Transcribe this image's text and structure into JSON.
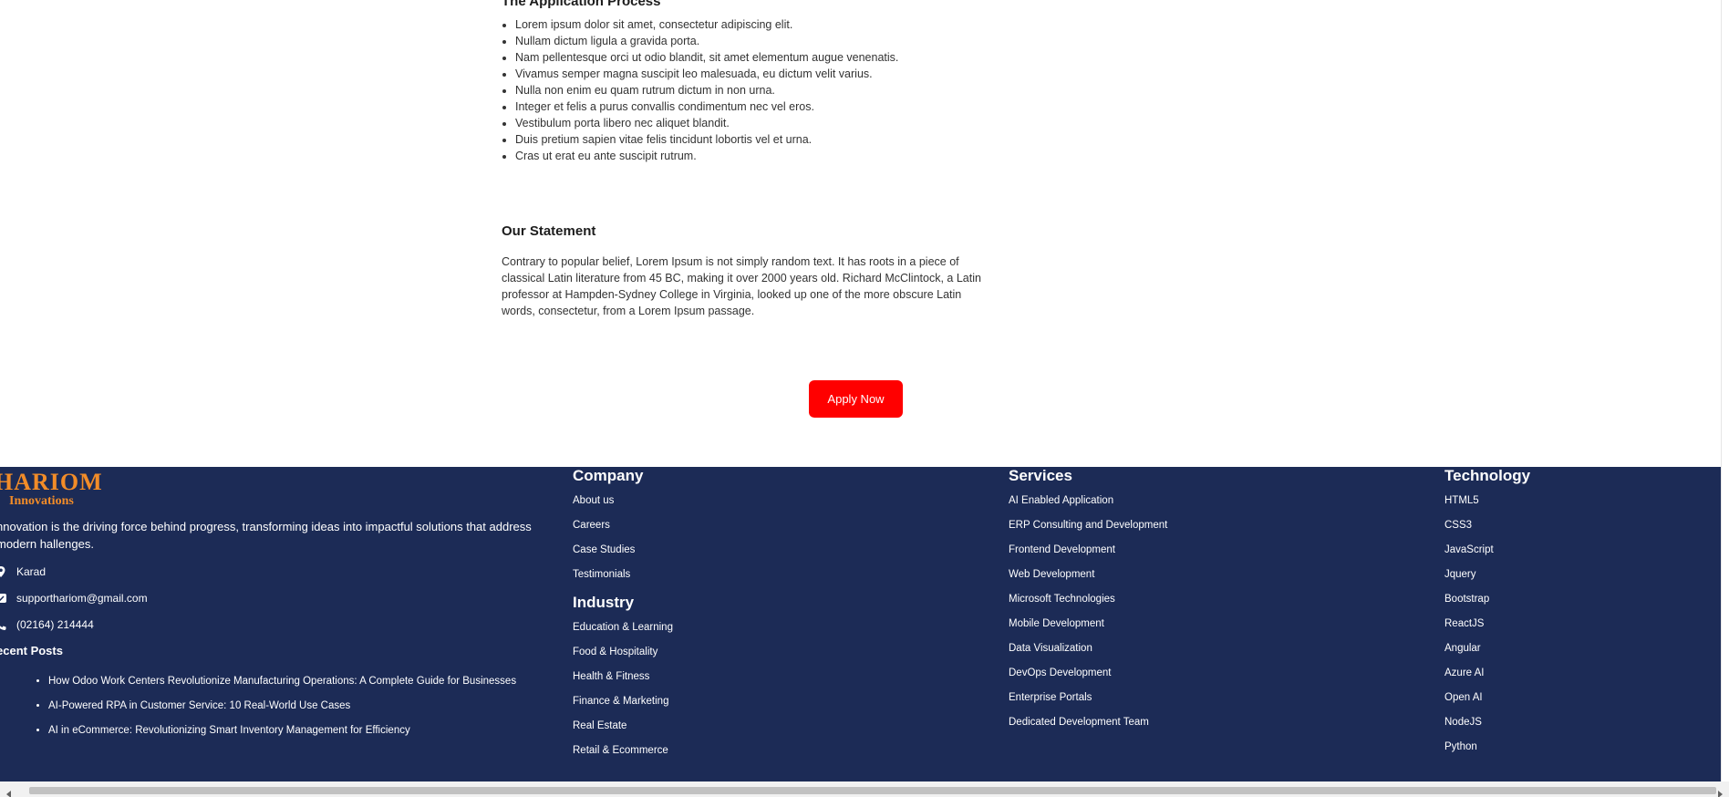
{
  "application": {
    "title": "The Application Process",
    "items": [
      "Lorem ipsum dolor sit amet, consectetur adipiscing elit.",
      "Nullam dictum ligula a gravida porta.",
      "Nam pellentesque orci ut odio blandit, sit amet elementum augue venenatis.",
      "Vivamus semper magna suscipit leo malesuada, eu dictum velit varius.",
      "Nulla non enim eu quam rutrum dictum in non urna.",
      "Integer et felis a purus convallis condimentum nec vel eros.",
      "Vestibulum porta libero nec aliquet blandit.",
      "Duis pretium sapien vitae felis tincidunt lobortis vel et urna.",
      "Cras ut erat eu ante suscipit rutrum."
    ]
  },
  "statement": {
    "title": "Our Statement",
    "text": "Contrary to popular belief, Lorem Ipsum is not simply random text. It has roots in a piece of classical Latin literature from 45 BC, making it over 2000 years old. Richard McClintock, a Latin professor at Hampden-Sydney College in Virginia, looked up one of the more obscure Latin words, consectetur, from a Lorem Ipsum passage."
  },
  "apply_button": "Apply Now",
  "footer": {
    "logo_main": "HARIOM",
    "logo_sub": "Innovations",
    "tagline": "nnovation is the driving force behind progress, transforming ideas into impactful solutions that address modern hallenges.",
    "contact": {
      "location": "Karad",
      "email": "supporthariom@gmail.com",
      "phone": "(02164) 214444"
    },
    "recent_posts_title": "ecent Posts",
    "recent_posts": [
      "How Odoo Work Centers Revolutionize Manufacturing Operations: A Complete Guide for Businesses",
      "AI-Powered RPA in Customer Service: 10 Real-World Use Cases",
      "AI in eCommerce: Revolutionizing Smart Inventory Management for Efficiency"
    ],
    "company": {
      "title": "Company",
      "links": [
        "About us",
        "Careers",
        "Case Studies",
        "Testimonials"
      ]
    },
    "industry": {
      "title": "Industry",
      "links": [
        "Education & Learning",
        "Food & Hospitality",
        "Health & Fitness",
        "Finance & Marketing",
        "Real Estate",
        "Retail & Ecommerce"
      ]
    },
    "services": {
      "title": "Services",
      "links": [
        "AI Enabled Application",
        "ERP Consulting and Development",
        "Frontend Development",
        "Web Development",
        "Microsoft Technologies",
        "Mobile Development",
        "Data Visualization",
        "DevOps Development",
        "Enterprise Portals",
        "Dedicated Development Team"
      ]
    },
    "technology": {
      "title": "Technology",
      "links": [
        "HTML5",
        "CSS3",
        "JavaScript",
        "Jquery",
        "Bootstrap",
        "ReactJS",
        "Angular",
        "Azure AI",
        "Open AI",
        "NodeJS",
        "Python"
      ]
    }
  },
  "colors": {
    "footer_bg": "#1c2b56",
    "accent_red": "#ff0000",
    "logo_orange": "#f28c28"
  },
  "icons": {
    "location": "map-pin-icon",
    "email": "mail-icon",
    "phone": "phone-icon"
  }
}
